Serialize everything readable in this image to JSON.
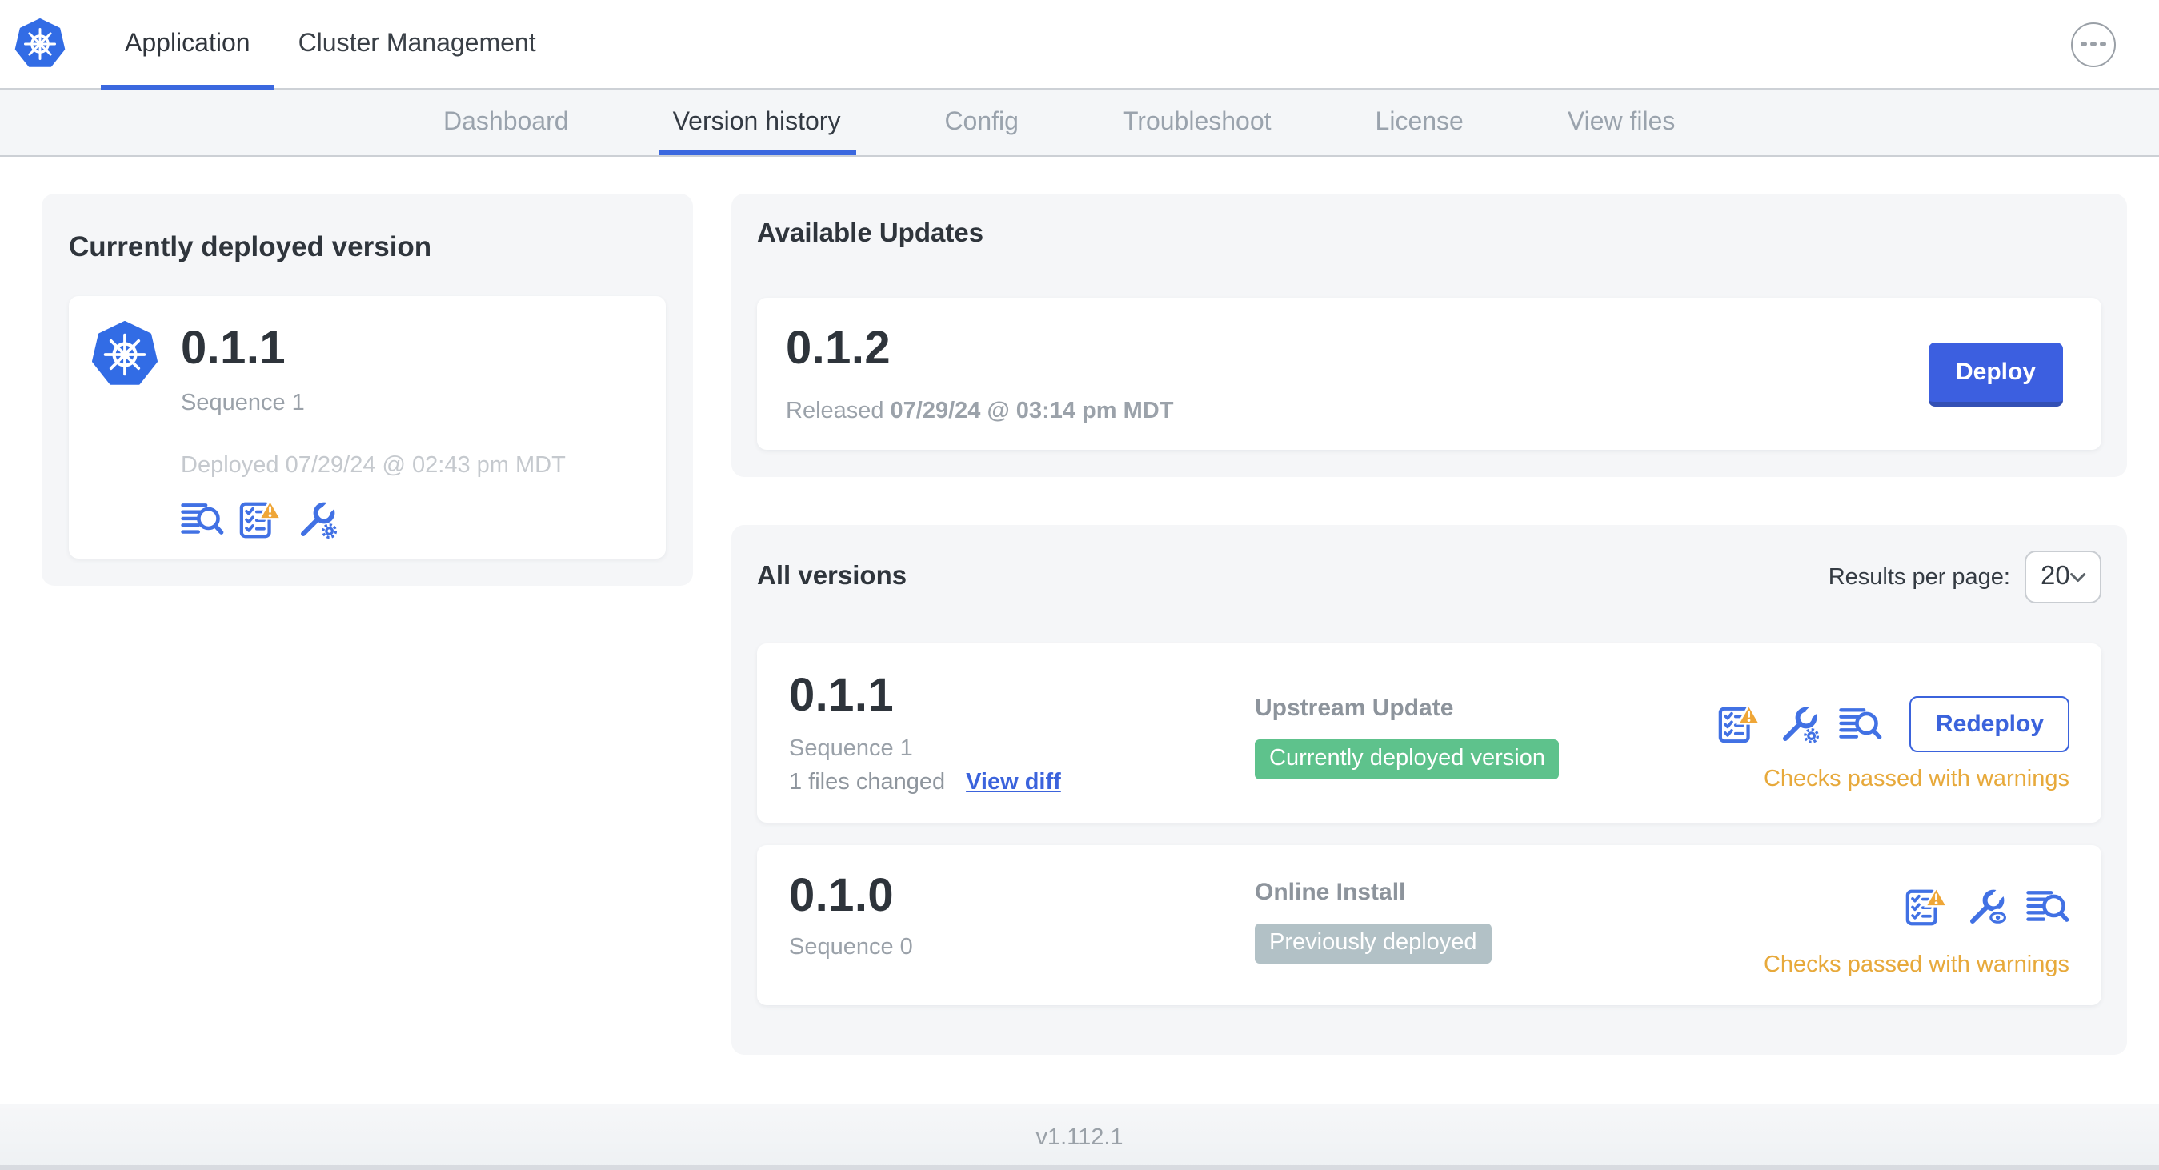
{
  "header": {
    "tabs": [
      {
        "label": "Application"
      },
      {
        "label": "Cluster Management"
      }
    ]
  },
  "subnav": {
    "tabs": [
      "Dashboard",
      "Version history",
      "Config",
      "Troubleshoot",
      "License",
      "View files"
    ],
    "active": "Version history"
  },
  "deployed_card": {
    "title": "Currently deployed version",
    "version": "0.1.1",
    "sequence": "Sequence 1",
    "deployed": "Deployed 07/29/24 @ 02:43 pm MDT",
    "icons": [
      "list-search",
      "checklist-warning",
      "wrench-gear"
    ]
  },
  "available_updates": {
    "title": "Available Updates",
    "version": "0.1.2",
    "released_prefix": "Released",
    "released_date": "07/29/24 @ 03:14 pm MDT",
    "deploy_label": "Deploy"
  },
  "all_versions": {
    "title": "All versions",
    "results_label": "Results per page:",
    "results_value": "20",
    "rows": [
      {
        "version": "0.1.1",
        "sequence": "Sequence 1",
        "files_changed": "1 files changed",
        "view_diff": "View diff",
        "source": "Upstream Update",
        "badge": "Currently deployed version",
        "badge_color": "#5ec28c",
        "checks": "Checks passed with warnings",
        "action": "Redeploy",
        "icons": [
          "checklist-warning",
          "wrench-gear",
          "list-search"
        ]
      },
      {
        "version": "0.1.0",
        "sequence": "Sequence 0",
        "source": "Online Install",
        "badge": "Previously deployed",
        "badge_color": "#b2c1c6",
        "checks": "Checks passed with warnings",
        "icons": [
          "checklist-warning",
          "wrench-eye",
          "list-search"
        ]
      }
    ]
  },
  "footer": {
    "version": "v1.112.1"
  },
  "colors": {
    "accent_blue": "#3c5fe0",
    "icon_blue": "#4171e4",
    "logo_blue": "#326ce5",
    "badge_green": "#5ec28c",
    "badge_gray": "#b2c1c6",
    "warning_orange": "#e7a93b",
    "panel_gray": "#f5f6f8"
  }
}
